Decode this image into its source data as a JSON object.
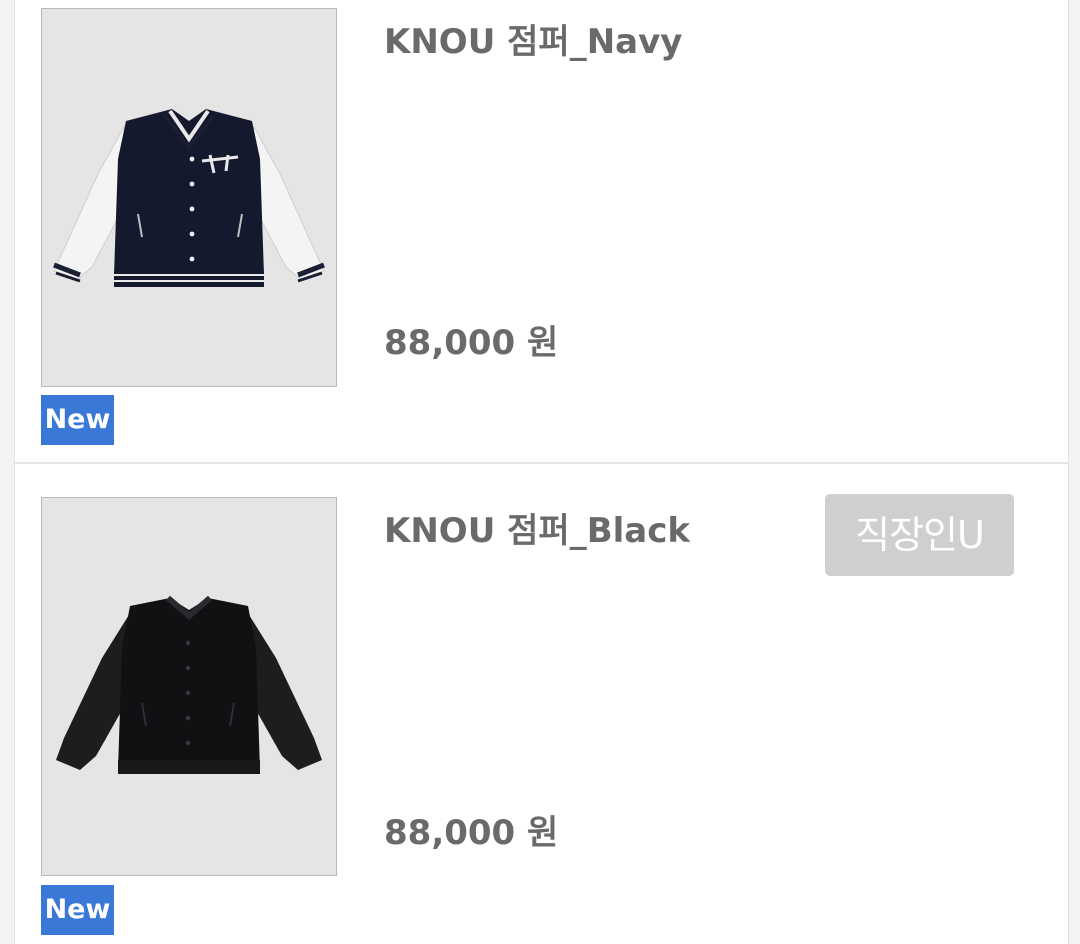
{
  "products": [
    {
      "title": "KNOU 점퍼_Navy",
      "price": "88,000 원",
      "badge": "New",
      "image_alt": "navy varsity jacket with white sleeves"
    },
    {
      "title": "KNOU 점퍼_Black",
      "price": "88,000 원",
      "badge": "New",
      "tag": "직장인U",
      "image_alt": "black varsity jacket with black leather sleeves"
    }
  ],
  "colors": {
    "badge_bg": "#3a78d8",
    "tag_bg": "#cfcfcf",
    "text": "#6a6a6a",
    "thumb_bg": "#e5e5e5"
  }
}
